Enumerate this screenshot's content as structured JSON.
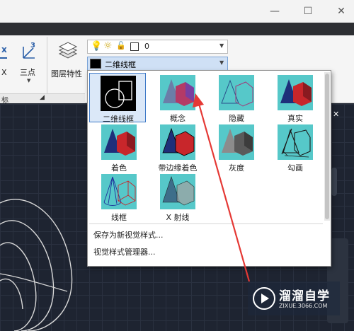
{
  "ribbon": {
    "x_axis_short": "X",
    "three_point_label": "三点",
    "layer_props_label": "图层特性",
    "panel_footer_label": "标",
    "layer_number": "0",
    "current_style": "二维线框"
  },
  "visual_styles": [
    {
      "name": "二维线框",
      "selected": true
    },
    {
      "name": "概念"
    },
    {
      "name": "隐藏"
    },
    {
      "name": "真实"
    },
    {
      "name": "着色"
    },
    {
      "name": "带边缘着色"
    },
    {
      "name": "灰度"
    },
    {
      "name": "勾画"
    },
    {
      "name": "线框"
    },
    {
      "name": "X 射线"
    }
  ],
  "menu": {
    "save_as": "保存为新视觉样式...",
    "manager": "视觉样式管理器..."
  },
  "watermark": {
    "name": "溜溜自学",
    "url": "ZIXUE.3066.COM"
  },
  "colors": {
    "thumb_bg": "#56c8c9",
    "selected_border": "#3d79c7",
    "arrow": "#e53935"
  }
}
